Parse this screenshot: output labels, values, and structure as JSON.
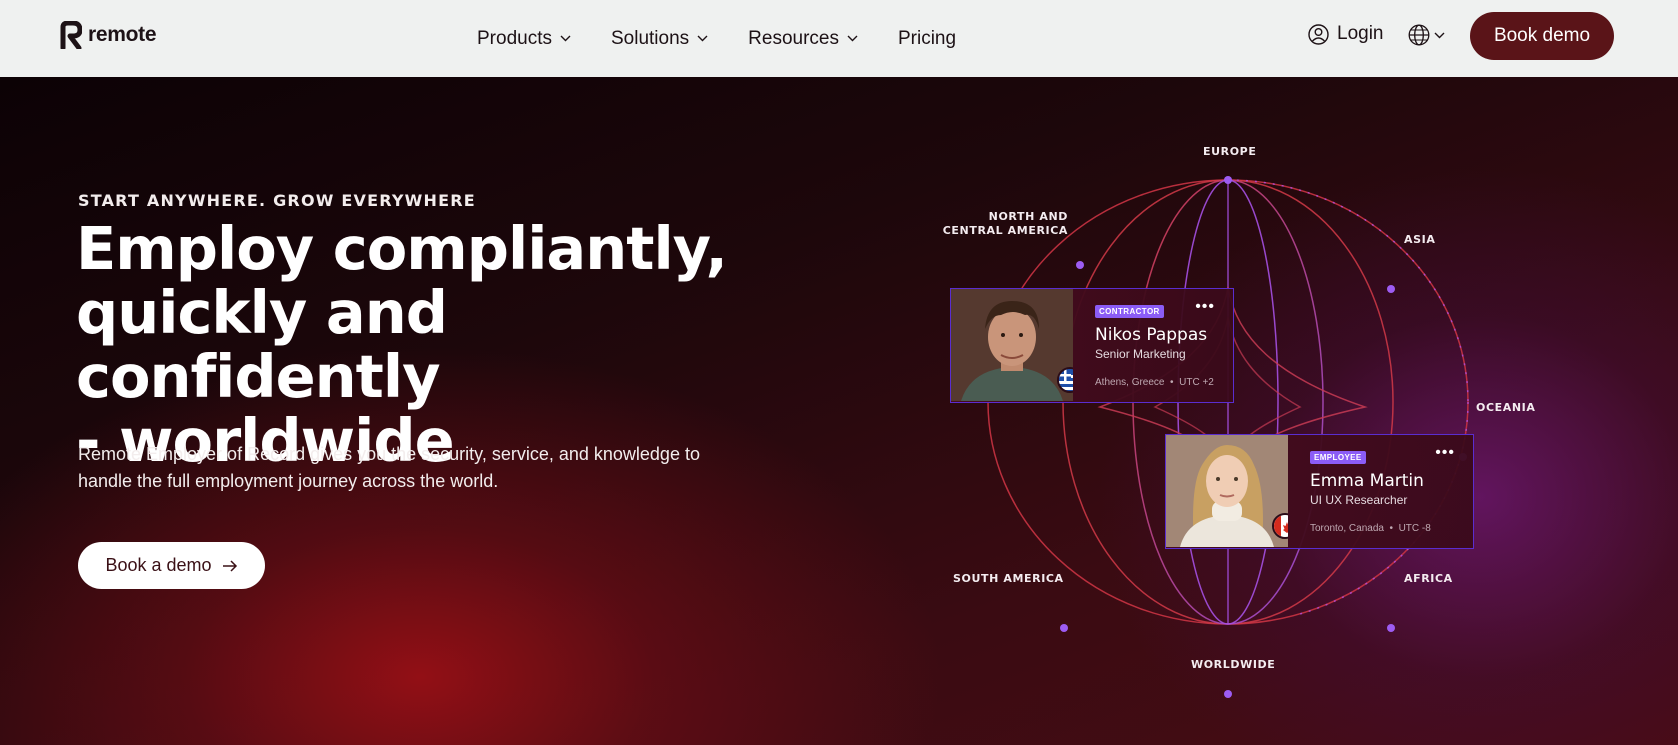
{
  "nav": {
    "logo_text": "remote",
    "links": [
      {
        "label": "Products",
        "dropdown": true
      },
      {
        "label": "Solutions",
        "dropdown": true
      },
      {
        "label": "Resources",
        "dropdown": true
      },
      {
        "label": "Pricing",
        "dropdown": false
      }
    ],
    "login_label": "Login",
    "book_demo_label": "Book demo"
  },
  "hero": {
    "eyebrow": "START ANYWHERE. GROW EVERYWHERE",
    "headline_line1": "Employ compliantly,",
    "headline_line2": "quickly and confidently",
    "headline_line3": "- worldwide",
    "subtext": "Remote Employer of Record gives you the security, service, and knowledge to handle the full employment journey across the world.",
    "cta_label": "Book a demo"
  },
  "globe": {
    "regions": {
      "europe": "EUROPE",
      "north_america": "NORTH AND CENTRAL AMERICA",
      "asia": "ASIA",
      "oceania": "OCEANIA",
      "south_america": "SOUTH AMERICA",
      "africa": "AFRICA",
      "worldwide": "WORLDWIDE"
    }
  },
  "cards": [
    {
      "badge": "CONTRACTOR",
      "name": "Nikos Pappas",
      "role": "Senior Marketing",
      "location": "Athens, Greece",
      "timezone": "UTC +2"
    },
    {
      "badge": "EMPLOYEE",
      "name": "Emma Martin",
      "role": "UI UX Researcher",
      "location": "Toronto, Canada",
      "timezone": "UTC -8"
    }
  ],
  "colors": {
    "brand": "#5a1418",
    "nav_bg": "#eff1f0",
    "accent_purple": "#8b5cf6",
    "line_red": "#d13a45"
  }
}
